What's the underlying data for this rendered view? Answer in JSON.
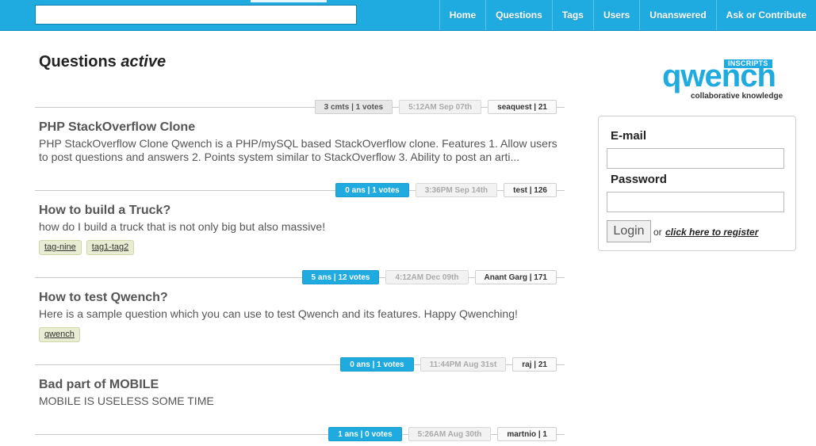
{
  "nav": {
    "items": [
      "Home",
      "Questions",
      "Tags",
      "Users",
      "Unanswered",
      "Ask or Contribute"
    ]
  },
  "search": {
    "value": "",
    "placeholder": ""
  },
  "page": {
    "title": "Questions",
    "title_em": "active"
  },
  "logo": {
    "badge": "INSCRIPTS",
    "word": "qwench",
    "tagline": "collaborative knowledge"
  },
  "login": {
    "email_label": "E-mail",
    "password_label": "Password",
    "login_button": "Login",
    "or_text": "or",
    "register_link": "click here to register"
  },
  "questions": [
    {
      "count": "3 cmts | 1 votes",
      "time": "5:12AM Sep 07th",
      "user": "seaquest | 21",
      "answered": false,
      "title": "PHP StackOverflow Clone",
      "excerpt": "PHP StackOverflow Clone Qwench is a PHP/mySQL based StackOverflow clone. Features 1. Allow users to post questions and answers 2. Points system similar to StackOverflow 3. Ability to post an arti...",
      "tags": []
    },
    {
      "count": "0 ans | 1 votes",
      "time": "3:36PM Sep 14th",
      "user": "test | 126",
      "answered": true,
      "title": "How to build a Truck?",
      "excerpt": "how do I build a truck that is not only big but also massive!",
      "tags": [
        "tag-nine",
        "tag1-tag2"
      ]
    },
    {
      "count": "5 ans | 12 votes",
      "time": "4:12AM Dec 09th",
      "user": "Anant Garg | 171",
      "answered": true,
      "title": "How to test Qwench?",
      "excerpt": "Here is a sample question which you can use to test Qwench and its features. Happy Qwenching!",
      "tags": [
        "qwench"
      ]
    },
    {
      "count": "0 ans | 1 votes",
      "time": "11:44PM Aug 31st",
      "user": "raj | 21",
      "answered": true,
      "title": "Bad part of MOBILE",
      "excerpt": "MOBILE IS USELESS SOME TIME",
      "tags": []
    },
    {
      "count": "1 ans | 0 votes",
      "time": "5:26AM Aug 30th",
      "user": "martnio | 1",
      "answered": true,
      "title": "",
      "excerpt": "",
      "tags": []
    }
  ],
  "colors": {
    "accent": "#1fabe0",
    "tag_bg": "#e8ecd2"
  }
}
